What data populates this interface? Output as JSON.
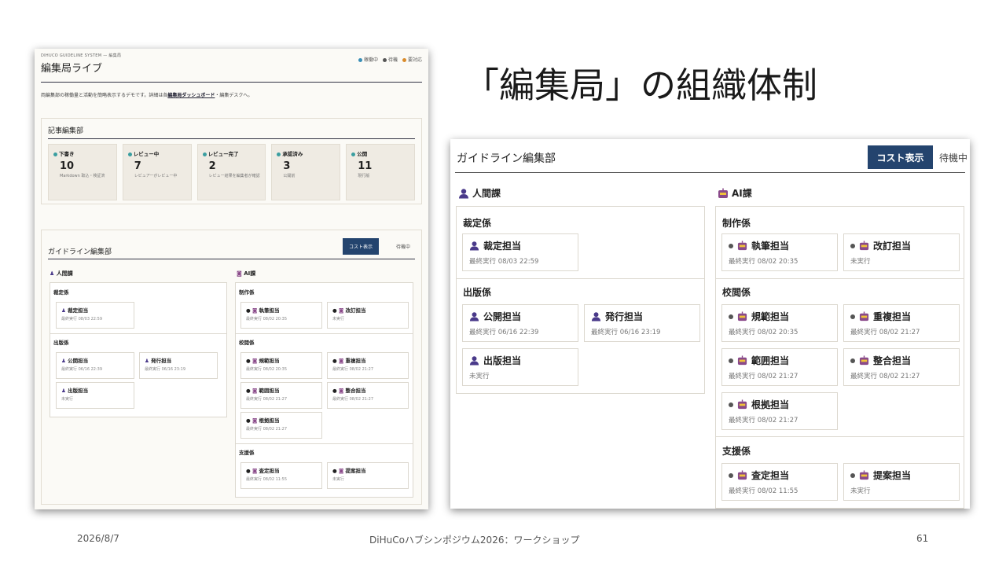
{
  "slide": {
    "title": "「編集局」の組織体制",
    "date": "2026/8/7",
    "footer": "DiHuCoハブシンポジウム2026：ワークショップ",
    "page": "61"
  },
  "left": {
    "system": "DIHUCO GUIDELINE SYSTEM — 編集局",
    "title": "編集局ライブ",
    "legend": [
      {
        "label": "稼働中",
        "color": "#3a8fb7"
      },
      {
        "label": "待機",
        "color": "#555"
      },
      {
        "label": "要対応",
        "color": "#d98b2b"
      }
    ],
    "desc_pre": "両編集部の稼働量と活動を簡略表示するデモです。詳細は各",
    "desc_link": "編集局ダッシュボード",
    "desc_post": "・編集デスクへ。",
    "section1": "記事編集部",
    "stats": [
      {
        "label": "下書き",
        "num": "10",
        "sub": "Markdown 取込・検証済",
        "color": "#3a9ea0"
      },
      {
        "label": "レビュー中",
        "num": "7",
        "sub": "レビュアーがレビュー中",
        "color": "#3a9ea0"
      },
      {
        "label": "レビュー完了",
        "num": "2",
        "sub": "レビュー結果を編集者が確認",
        "color": "#3a9ea0"
      },
      {
        "label": "承認済み",
        "num": "3",
        "sub": "公開前",
        "color": "#3a9ea0"
      },
      {
        "label": "公開",
        "num": "11",
        "sub": "現行版",
        "color": "#3a9ea0"
      }
    ],
    "section2": "ガイドライン編集部",
    "cost": "コスト表示",
    "status": "待機中"
  },
  "guideline": {
    "title": "ガイドライン編集部",
    "cost_button": "コスト表示",
    "status": "待機中",
    "human": {
      "name": "人間課",
      "groups": [
        {
          "name": "裁定係",
          "items": [
            {
              "name": "裁定担当",
              "time": "最終実行 08/03 22:59"
            }
          ]
        },
        {
          "name": "出版係",
          "items": [
            {
              "name": "公開担当",
              "time": "最終実行 06/16 22:39"
            },
            {
              "name": "発行担当",
              "time": "最終実行 06/16 23:19"
            },
            {
              "name": "出版担当",
              "time": "未実行"
            }
          ]
        }
      ]
    },
    "ai": {
      "name": "AI課",
      "groups": [
        {
          "name": "制作係",
          "items": [
            {
              "name": "執筆担当",
              "time": "最終実行 08/02 20:35"
            },
            {
              "name": "改訂担当",
              "time": "未実行"
            }
          ]
        },
        {
          "name": "校閲係",
          "items": [
            {
              "name": "規範担当",
              "time": "最終実行 08/02 20:35"
            },
            {
              "name": "重複担当",
              "time": "最終実行 08/02 21:27"
            },
            {
              "name": "範囲担当",
              "time": "最終実行 08/02 21:27"
            },
            {
              "name": "整合担当",
              "time": "最終実行 08/02 21:27"
            },
            {
              "name": "根拠担当",
              "time": "最終実行 08/02 21:27"
            }
          ]
        },
        {
          "name": "支援係",
          "items": [
            {
              "name": "査定担当",
              "time": "最終実行 08/02 11:55"
            },
            {
              "name": "提案担当",
              "time": "未実行"
            }
          ]
        }
      ]
    }
  }
}
